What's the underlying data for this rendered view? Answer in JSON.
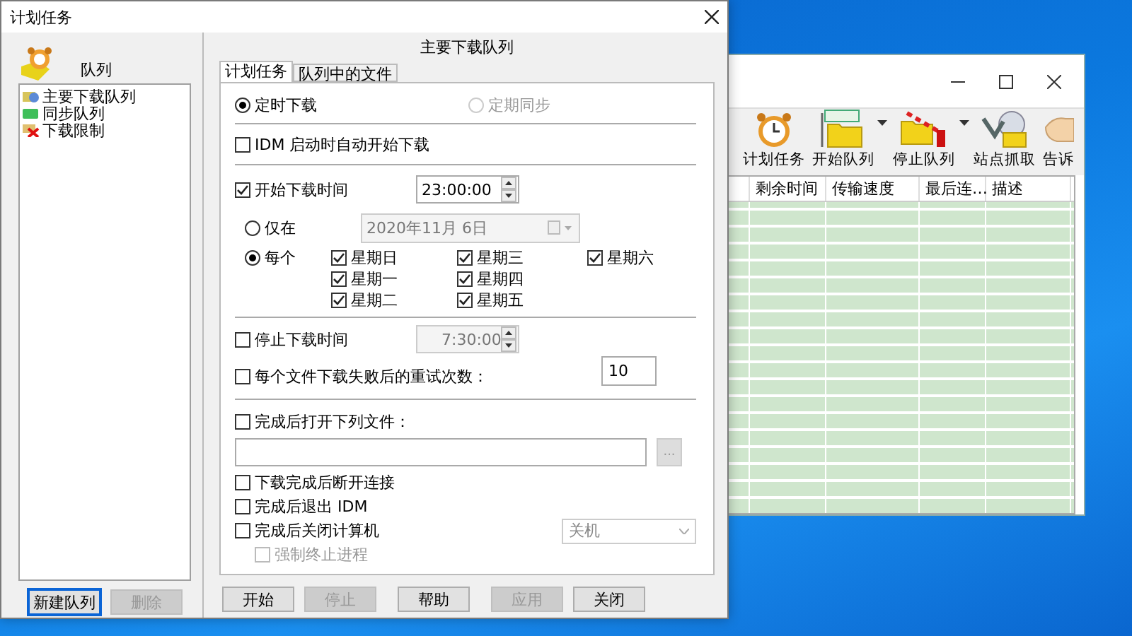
{
  "background_window": {
    "toolbar": [
      {
        "label": "计划任务",
        "kind": "clock",
        "has_menu": false
      },
      {
        "label": "开始队列",
        "kind": "start",
        "has_menu": true
      },
      {
        "label": "停止队列",
        "kind": "stop",
        "has_menu": true
      },
      {
        "label": "站点抓取",
        "kind": "grabber",
        "has_menu": false
      },
      {
        "label": "告诉",
        "kind": "hand",
        "has_menu": false
      }
    ],
    "columns": [
      "剩余时间",
      "传输速度",
      "最后连…",
      "描述"
    ]
  },
  "dialog": {
    "title": "计划任务",
    "queues": {
      "label": "队列",
      "items": [
        {
          "label": "主要下载队列",
          "kind": "queue"
        },
        {
          "label": "同步队列",
          "kind": "sync"
        },
        {
          "label": "下载限制",
          "kind": "limit"
        }
      ]
    },
    "queue_buttons": [
      {
        "label": "新建队列",
        "disabled": false,
        "focused": true
      },
      {
        "label": "删除",
        "disabled": true,
        "focused": false
      }
    ],
    "queue_title": "主要下载队列",
    "tabs": [
      {
        "label": "计划任务",
        "selected": true
      },
      {
        "label": "队列中的文件",
        "selected": false
      }
    ],
    "mode": [
      {
        "label": "定时下载",
        "selected": true,
        "disabled": false
      },
      {
        "label": "定期同步",
        "selected": false,
        "disabled": true
      }
    ],
    "auto_start": {
      "label": "IDM 启动时自动开始下载",
      "checked": false
    },
    "start_time": {
      "label": "开始下载时间",
      "checked": true,
      "value": "23:00:00",
      "disabled": false
    },
    "once": {
      "label": "仅在",
      "selected": false,
      "date": "2020年11月 6日",
      "disabled": true
    },
    "weekly": {
      "label": "每个",
      "selected": true,
      "days": [
        {
          "label": "星期日",
          "checked": true
        },
        {
          "label": "星期一",
          "checked": true
        },
        {
          "label": "星期二",
          "checked": true
        },
        {
          "label": "星期三",
          "checked": true
        },
        {
          "label": "星期四",
          "checked": true
        },
        {
          "label": "星期五",
          "checked": true
        },
        {
          "label": "星期六",
          "checked": true
        }
      ]
    },
    "stop_time": {
      "label": "停止下载时间",
      "checked": false,
      "value": "7:30:00",
      "disabled": true
    },
    "retry": {
      "label": "每个文件下载失败后的重试次数：",
      "checked": false,
      "value": "10"
    },
    "open_file": {
      "label": "完成后打开下列文件：",
      "checked": false,
      "browse": "..."
    },
    "after": [
      {
        "label": "下载完成后断开连接",
        "checked": false
      },
      {
        "label": "完成后退出 IDM",
        "checked": false
      },
      {
        "label": "完成后关闭计算机",
        "checked": false,
        "option": "关机"
      }
    ],
    "force": {
      "label": "强制终止进程",
      "checked": false,
      "disabled": true
    },
    "buttons": [
      {
        "label": "开始",
        "disabled": false
      },
      {
        "label": "停止",
        "disabled": true
      },
      {
        "label": "帮助",
        "disabled": false
      },
      {
        "label": "应用",
        "disabled": true
      },
      {
        "label": "关闭",
        "disabled": false
      }
    ]
  }
}
